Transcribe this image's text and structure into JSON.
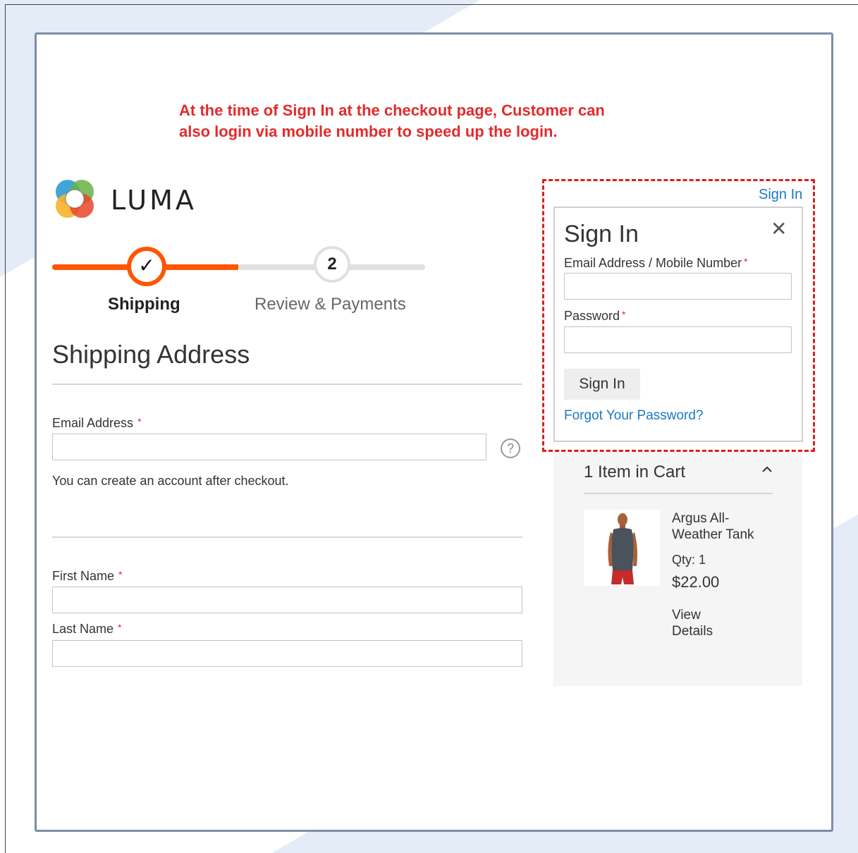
{
  "annotation": {
    "line1": "At the time of Sign In at the checkout page, Customer can",
    "line2": "also login via mobile number to speed up the login."
  },
  "logo": {
    "text": "LUMA",
    "colors": [
      "#f7b22c",
      "#e8452c",
      "#2c9bd6",
      "#66b345"
    ]
  },
  "progress": {
    "steps": [
      {
        "number": "✓",
        "label": "Shipping",
        "state": "done"
      },
      {
        "number": "2",
        "label": "Review & Payments",
        "state": "pending"
      }
    ],
    "active_color": "#ff5501"
  },
  "shipping": {
    "title": "Shipping Address",
    "email_label": "Email Address",
    "help_symbol": "?",
    "account_note": "You can create an account after checkout.",
    "first_name_label": "First Name",
    "last_name_label": "Last Name",
    "required_mark": "*"
  },
  "signin": {
    "link": "Sign In",
    "title": "Sign In",
    "close_symbol": "✕",
    "email_label": "Email Address / Mobile Number",
    "password_label": "Password",
    "button": "Sign In",
    "forgot": "Forgot Your Password?",
    "highlight_color": "#d91f1f",
    "link_color": "#1979c3"
  },
  "cart": {
    "title": "1 Item in Cart",
    "caret": "^",
    "item": {
      "name": "Argus All-Weather Tank",
      "qty": "Qty: 1",
      "price": "$22.00",
      "details": "View Details"
    }
  }
}
